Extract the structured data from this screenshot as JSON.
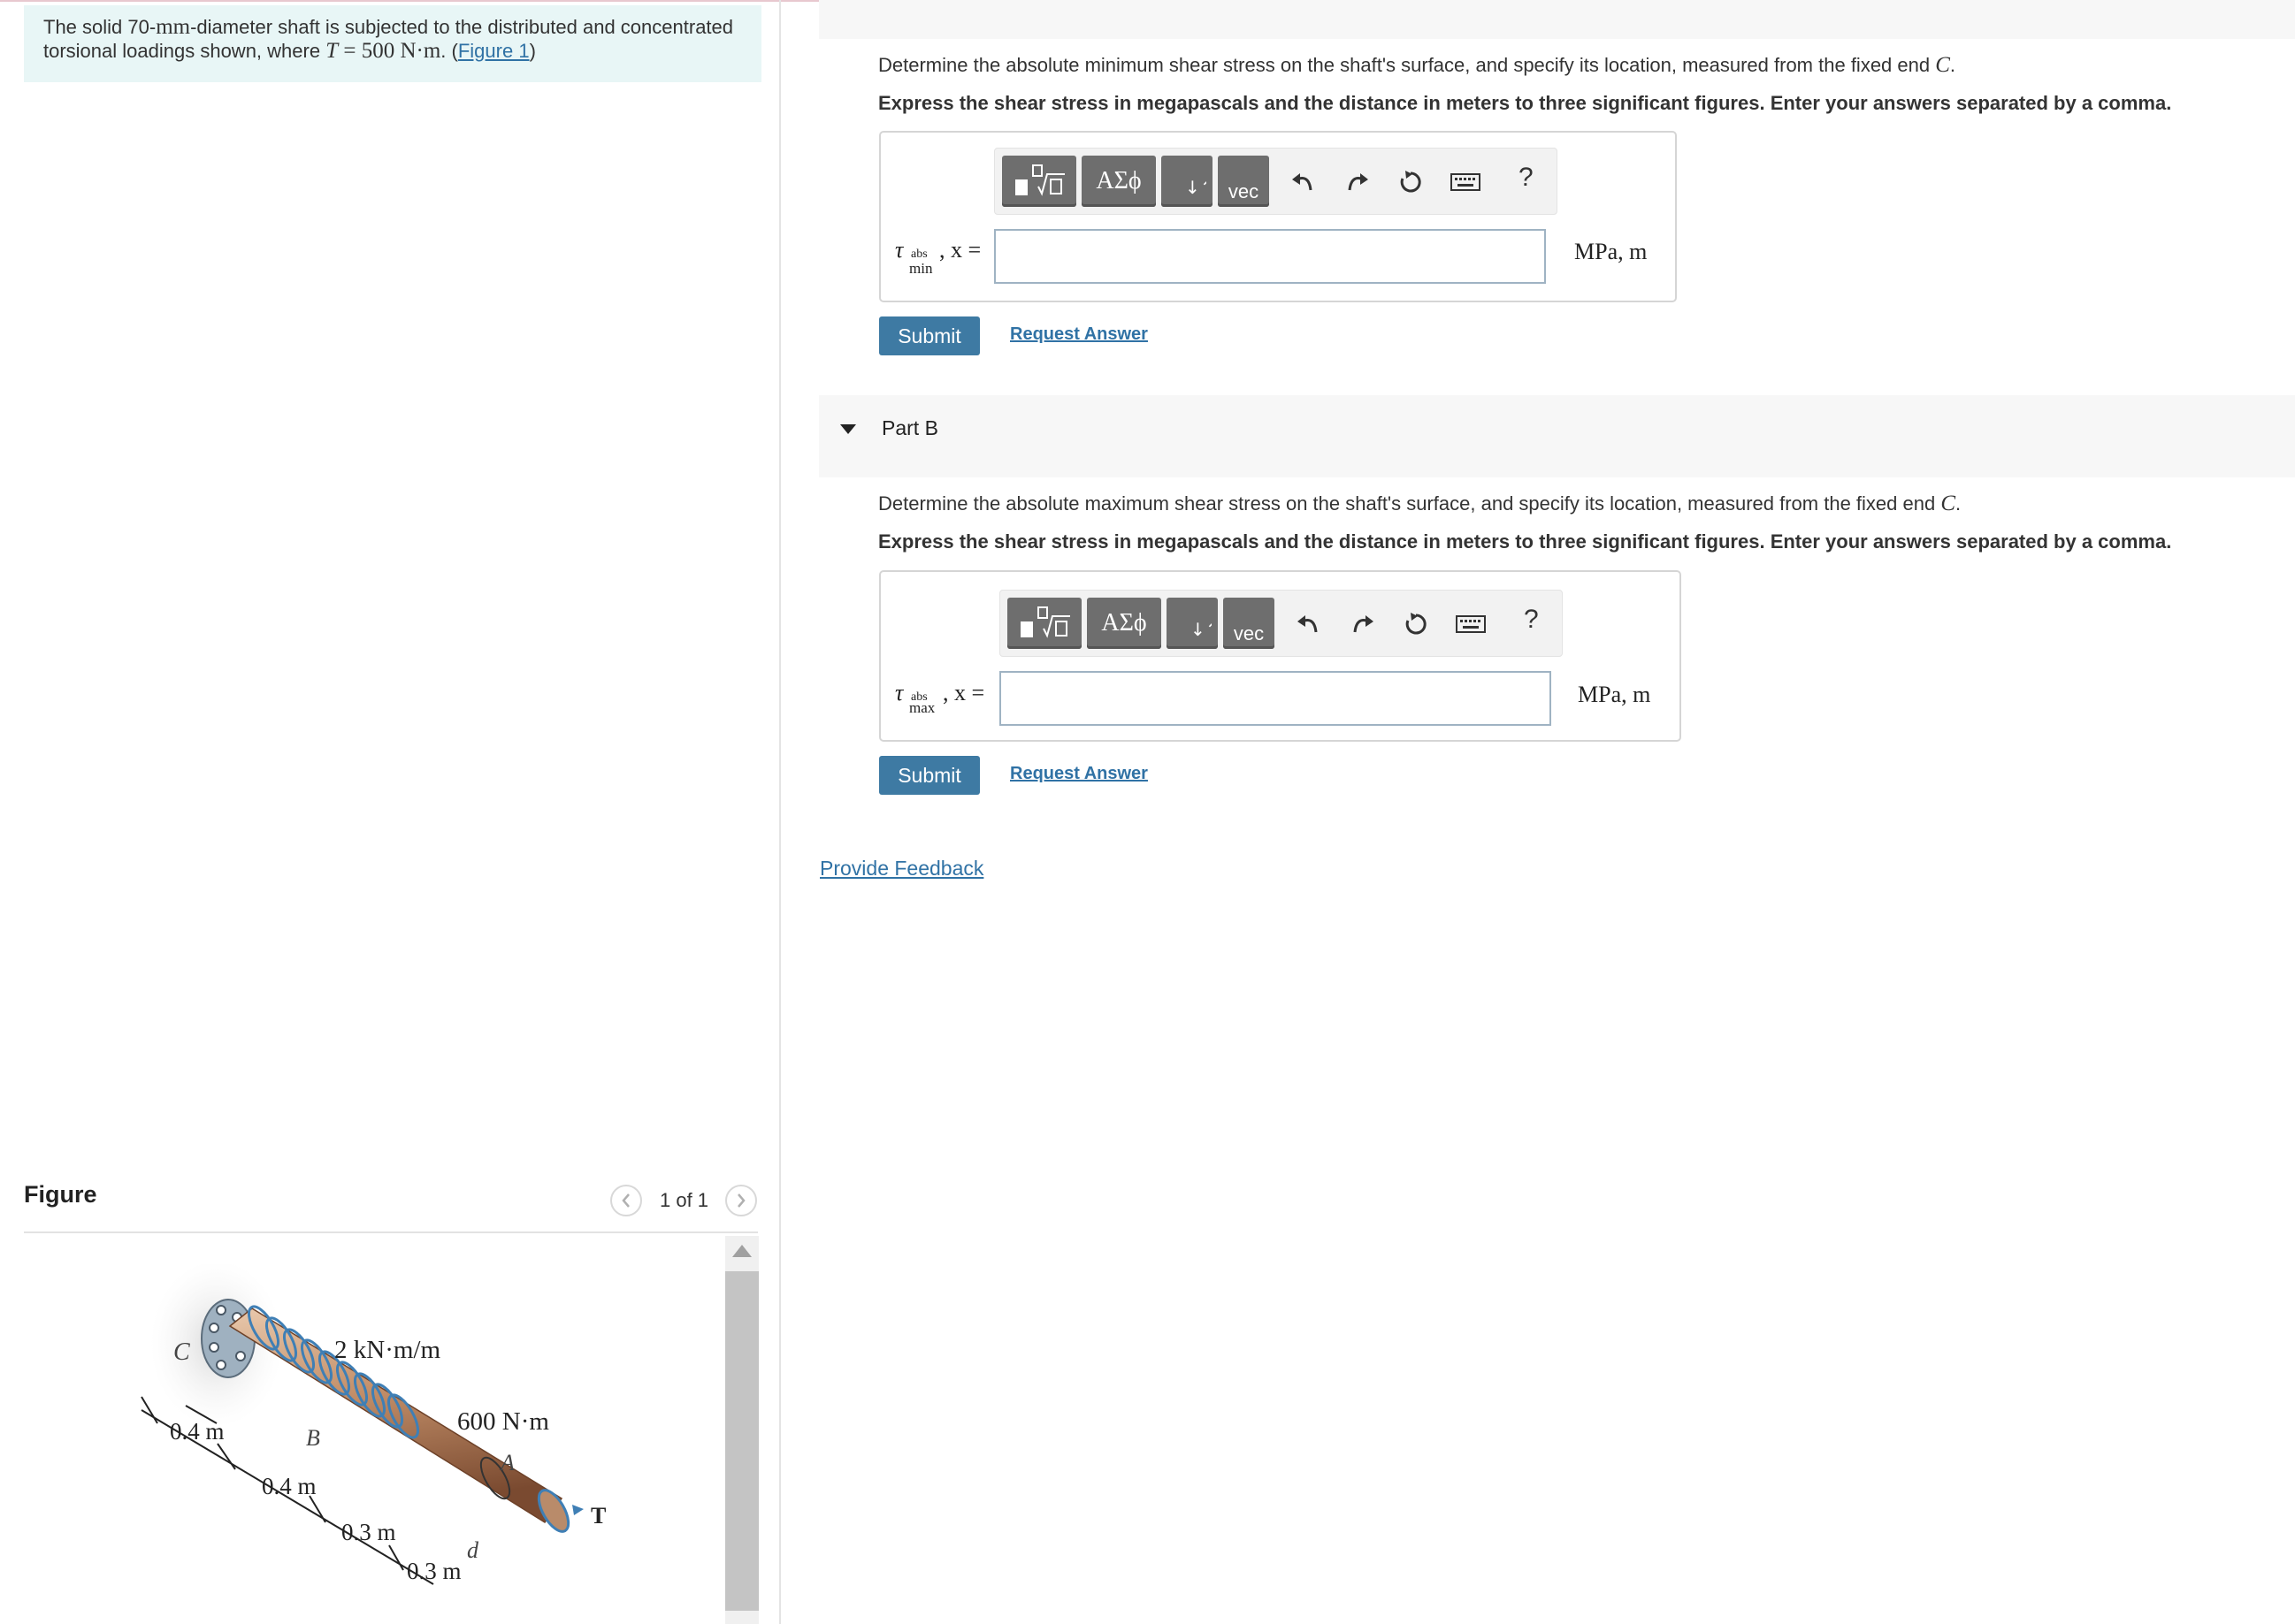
{
  "problem": {
    "text_before": "The solid 70-",
    "unit_mm": "mm",
    "text_mid": "-diameter shaft is subjected to the distributed and concentrated torsional loadings shown, where ",
    "var_T": "T",
    "equation": " = 500 N·m",
    "text_after": ". (",
    "figure_link": "Figure 1",
    "close": ")"
  },
  "part_a": {
    "question_prefix": "Determine the absolute minimum shear stress on the shaft's surface, and specify its location, measured from the fixed end ",
    "question_var": "C",
    "question_suffix": ".",
    "instruction": "Express the shear stress in megapascals and the distance in meters to three significant figures. Enter your answers separated by a comma.",
    "label_tau": "τ",
    "label_sup": "abs",
    "label_sub": "min",
    "label_rest": ", x =",
    "input_value": "",
    "units": "MPa, m",
    "submit_label": "Submit",
    "request_label": "Request Answer"
  },
  "part_b": {
    "title": "Part B",
    "question_prefix": "Determine the absolute maximum shear stress on the shaft's surface, and specify its location, measured from the fixed end ",
    "question_var": "C",
    "question_suffix": ".",
    "instruction": "Express the shear stress in megapascals and the distance in meters to three significant figures. Enter your answers separated by a comma.",
    "label_tau": "τ",
    "label_sup": "abs",
    "label_sub": "max",
    "label_rest": ", x =",
    "input_value": "",
    "units": "MPa, m",
    "submit_label": "Submit",
    "request_label": "Request Answer"
  },
  "toolbar": {
    "greek_label": "ΑΣϕ",
    "vec_label": "vec",
    "help_label": "?"
  },
  "feedback_link": "Provide Feedback",
  "figure_panel": {
    "title": "Figure",
    "counter": "1 of 1",
    "labels": {
      "C": "C",
      "B": "B",
      "A": "A",
      "d": "d",
      "T": "T",
      "distributed": "2 kN·m/m",
      "concentrated": "600 N·m",
      "dim1": "0.4 m",
      "dim2": "0.4 m",
      "dim3": "0.3 m",
      "dim4": "0.3 m"
    }
  }
}
